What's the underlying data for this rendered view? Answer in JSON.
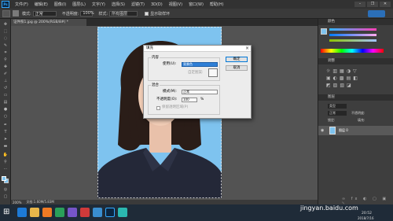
{
  "menubar": {
    "logo": "Ps",
    "items": [
      "文件(F)",
      "编辑(E)",
      "图像(I)",
      "图层(L)",
      "文字(Y)",
      "选择(S)",
      "滤镜(T)",
      "3D(D)",
      "视图(V)",
      "窗口(W)",
      "帮助(H)"
    ]
  },
  "options": {
    "mode_label": "模式:",
    "mode_value": "正常",
    "opacity_label": "不透明度:",
    "opacity_value": "100%",
    "style_label": "样式:",
    "style_value": "所有图层",
    "checkbox_label": "显示取样环"
  },
  "document": {
    "tab_title": "证件照1.jpg @ 200%(RGB/8#) *",
    "status_zoom": "200%",
    "status_doc": "文档:1.60M/5.83M"
  },
  "dialog": {
    "title": "填充",
    "close": "×",
    "content_group": "内容",
    "use_label": "使用(U):",
    "use_value": "背景色",
    "custom_pattern_label": "自定图案:",
    "blend_group": "混合",
    "mode_label": "模式(M):",
    "mode_value": "正常",
    "opacity_label": "不透明度(O):",
    "opacity_value": "100",
    "opacity_unit": "%",
    "preserve_label": "保留透明区域(P)",
    "ok_label": "确定",
    "cancel_label": "取消"
  },
  "panels": {
    "color_tab": "颜色",
    "adjust_tab": "调整",
    "layers_tab": "图层",
    "layer_kind": "类型",
    "layer_mode": "正常",
    "layer_opacity": "不透明度:",
    "lock_label": "锁定:",
    "fill_label": "填充:",
    "layer_name": "图层 0"
  },
  "taskbar": {
    "time": "20:52",
    "date": "2018/7/16",
    "watermark": "jingyan.baidu.com"
  },
  "colors": {
    "photo_bg": "#7ec3ef",
    "ps_blue": "#31a8ff"
  }
}
